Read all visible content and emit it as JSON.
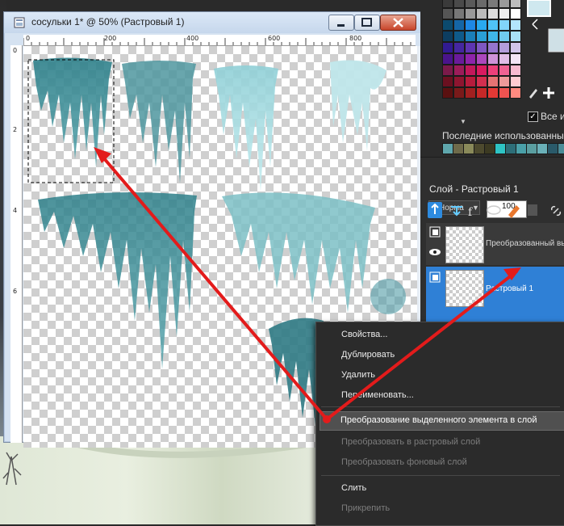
{
  "document": {
    "title": "сосульки 1* @  50% (Растровый 1)",
    "ruler_top_labels": [
      "0",
      "200",
      "400",
      "600",
      "800"
    ],
    "ruler_left_labels": [
      "0",
      "2",
      "4",
      "6"
    ]
  },
  "palette": {
    "recent_label": "Последние использованные",
    "all_label": "Все и",
    "all_checked": true,
    "swatch_rows": [
      [
        "#3a3a3a",
        "#4a4a4a",
        "#5a5a5a",
        "#6a6a6a",
        "#7a7a7a",
        "#9a9a9a",
        "#bdbdbd"
      ],
      [
        "#555555",
        "#777777",
        "#999999",
        "#bbbbbb",
        "#dddddd",
        "#eeeeee",
        "#ffffff"
      ],
      [
        "#0c4a6e",
        "#1565a6",
        "#1e88e5",
        "#29a9ef",
        "#4fc3f7",
        "#81d4fa",
        "#b3e5fc"
      ],
      [
        "#0d3d60",
        "#0f5a8a",
        "#1b7fb8",
        "#2a9fd6",
        "#3fb6e8",
        "#6fcbef",
        "#a8e0f6"
      ],
      [
        "#311b92",
        "#4527a0",
        "#5e35b1",
        "#7e57c2",
        "#9575cd",
        "#b39ddb",
        "#d1c4e9"
      ],
      [
        "#4a148c",
        "#6a1b9a",
        "#8e24aa",
        "#ab47bc",
        "#ce93d8",
        "#e1bee7",
        "#f3e5f5"
      ],
      [
        "#7b1a4a",
        "#9c1c5a",
        "#c2185b",
        "#d81b60",
        "#ec407a",
        "#f06292",
        "#f8bbd0"
      ],
      [
        "#6b1020",
        "#8e1530",
        "#b71c3c",
        "#d32f4f",
        "#e57373",
        "#ef9a9a",
        "#ffcdd2"
      ],
      [
        "#5a1010",
        "#7a1a1a",
        "#a12020",
        "#c62828",
        "#e53935",
        "#ef5350",
        "#ff8a80"
      ]
    ],
    "recent_colors": [
      "#5fa7ad",
      "#6e6a4a",
      "#8a8a5a",
      "#4d4a2e",
      "#3c3a22",
      "#2ec4c4",
      "#2d6e78",
      "#4aa0a8",
      "#5a9ea0",
      "#6ab0b8",
      "#2a5a6a",
      "#4b8c98"
    ]
  },
  "layers": {
    "title": "Слой - Растровый 1",
    "blend_mode": "Норма",
    "opacity": "100",
    "items": [
      {
        "name": "Преобразованный выде",
        "selected": false
      },
      {
        "name": "Растровый 1",
        "selected": true
      }
    ]
  },
  "context_menu": {
    "items": [
      {
        "label": "Свойства...",
        "disabled": false
      },
      {
        "label": "Дублировать",
        "disabled": false
      },
      {
        "label": "Удалить",
        "disabled": false
      },
      {
        "label": "Переименовать...",
        "disabled": false
      },
      {
        "label": "Преобразование выделенного элемента в слой",
        "disabled": false,
        "highlighted": true
      },
      {
        "label": "Преобразовать в растровый слой",
        "disabled": true
      },
      {
        "label": "Преобразовать фоновый слой",
        "disabled": true
      },
      {
        "label": "Слить",
        "disabled": false
      },
      {
        "label": "Прикрепить",
        "disabled": true
      }
    ]
  },
  "colors": {
    "annotation_arrow": "#e31b1b",
    "icicle": "#3f8c95",
    "icicle_light": "#a8dbe0",
    "selection_highlight": "#2f80d6"
  }
}
